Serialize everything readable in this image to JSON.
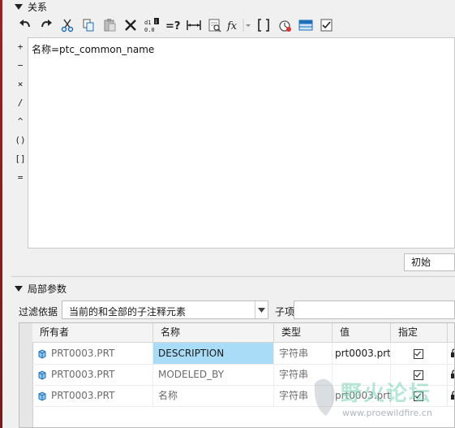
{
  "relations": {
    "title": "关系",
    "toolbar": [
      {
        "name": "undo-icon"
      },
      {
        "name": "redo-icon"
      },
      {
        "name": "cut-icon"
      },
      {
        "name": "copy-icon"
      },
      {
        "name": "paste-icon"
      },
      {
        "name": "delete-icon"
      },
      {
        "name": "sort-icon"
      },
      {
        "name": "evaluate-icon"
      },
      {
        "name": "measure-icon"
      },
      {
        "name": "verify-icon"
      },
      {
        "name": "function-icon"
      },
      {
        "name": "brackets-icon"
      },
      {
        "name": "timer-icon"
      },
      {
        "name": "table-icon"
      },
      {
        "name": "checklist-icon"
      }
    ],
    "operators": [
      "+",
      "−",
      "×",
      "/",
      "^",
      "()",
      "[]",
      "="
    ],
    "editor_text": "名称=ptc_common_name",
    "init_combo": "初始"
  },
  "local_params": {
    "title": "局部参数",
    "filter_label": "过滤依据",
    "filter_value": "当前的和全部的子注释元素",
    "sub_label": "子项",
    "columns": [
      "所有者",
      "名称",
      "类型",
      "值",
      "指定"
    ],
    "rows": [
      {
        "owner": "PRT0003.PRT",
        "name": "DESCRIPTION",
        "type": "字符串",
        "value": "prt0003.prt",
        "designated": true
      },
      {
        "owner": "PRT0003.PRT",
        "name": "MODELED_BY",
        "type": "字符串",
        "value": "",
        "designated": true
      },
      {
        "owner": "PRT0003.PRT",
        "name": "名称",
        "type": "字符串",
        "value": "prt0003.prt",
        "designated": true
      }
    ]
  },
  "watermark": {
    "text": "野火论坛",
    "url": "www.proewildfire.cn"
  },
  "colors": {
    "selection": "#a8dcf7",
    "accent_icon": "#1e6fb8"
  }
}
